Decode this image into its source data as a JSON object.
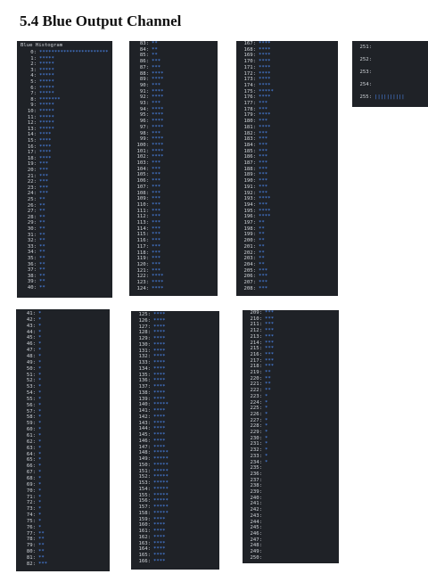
{
  "title": "5.4 Blue Output Channel",
  "histogram_header": "Blue Histogram",
  "panels": [
    {
      "id": "p1",
      "rows": [
        [
          "0:",
          "***********************"
        ],
        [
          "1:",
          "*****"
        ],
        [
          "2:",
          "*****"
        ],
        [
          "3:",
          "*****"
        ],
        [
          "4:",
          "*****"
        ],
        [
          "5:",
          "*****"
        ],
        [
          "6:",
          "*****"
        ],
        [
          "7:",
          "*****"
        ],
        [
          "8:",
          "*******"
        ],
        [
          "9:",
          "*****"
        ],
        [
          "10:",
          "*****"
        ],
        [
          "11:",
          "*****"
        ],
        [
          "12:",
          "*****"
        ],
        [
          "13:",
          "*****"
        ],
        [
          "14:",
          "****"
        ],
        [
          "15:",
          "****"
        ],
        [
          "16:",
          "****"
        ],
        [
          "17:",
          "****"
        ],
        [
          "18:",
          "****"
        ],
        [
          "19:",
          "***"
        ],
        [
          "20:",
          "***"
        ],
        [
          "21:",
          "***"
        ],
        [
          "22:",
          "***"
        ],
        [
          "23:",
          "***"
        ],
        [
          "24:",
          "***"
        ],
        [
          "25:",
          "**"
        ],
        [
          "26:",
          "**"
        ],
        [
          "27:",
          "**"
        ],
        [
          "28:",
          "**"
        ],
        [
          "29:",
          "**"
        ],
        [
          "30:",
          "**"
        ],
        [
          "31:",
          "**"
        ],
        [
          "32:",
          "**"
        ],
        [
          "33:",
          "**"
        ],
        [
          "34:",
          "**"
        ],
        [
          "35:",
          "**"
        ],
        [
          "36:",
          "**"
        ],
        [
          "37:",
          "**"
        ],
        [
          "38:",
          "**"
        ],
        [
          "39:",
          "**"
        ],
        [
          "40:",
          "**"
        ]
      ]
    },
    {
      "id": "p2",
      "rows": [
        [
          "83:",
          "**"
        ],
        [
          "84:",
          "**"
        ],
        [
          "85:",
          "**"
        ],
        [
          "86:",
          "***"
        ],
        [
          "87:",
          "***"
        ],
        [
          "88:",
          "****"
        ],
        [
          "89:",
          "****"
        ],
        [
          "90:",
          "***"
        ],
        [
          "91:",
          "****"
        ],
        [
          "92:",
          "****"
        ],
        [
          "93:",
          "***"
        ],
        [
          "94:",
          "****"
        ],
        [
          "95:",
          "****"
        ],
        [
          "96:",
          "****"
        ],
        [
          "97:",
          "****"
        ],
        [
          "98:",
          "***"
        ],
        [
          "99:",
          "****"
        ],
        [
          "100:",
          "****"
        ],
        [
          "101:",
          "****"
        ],
        [
          "102:",
          "****"
        ],
        [
          "103:",
          "***"
        ],
        [
          "104:",
          "***"
        ],
        [
          "105:",
          "***"
        ],
        [
          "106:",
          "***"
        ],
        [
          "107:",
          "***"
        ],
        [
          "108:",
          "***"
        ],
        [
          "109:",
          "***"
        ],
        [
          "110:",
          "***"
        ],
        [
          "111:",
          "***"
        ],
        [
          "112:",
          "***"
        ],
        [
          "113:",
          "***"
        ],
        [
          "114:",
          "***"
        ],
        [
          "115:",
          "***"
        ],
        [
          "116:",
          "***"
        ],
        [
          "117:",
          "***"
        ],
        [
          "118:",
          "***"
        ],
        [
          "119:",
          "***"
        ],
        [
          "120:",
          "***"
        ],
        [
          "121:",
          "***"
        ],
        [
          "122:",
          "****"
        ],
        [
          "123:",
          "****"
        ],
        [
          "124:",
          "****"
        ]
      ]
    },
    {
      "id": "p3",
      "rows": [
        [
          "167:",
          "****"
        ],
        [
          "168:",
          "****"
        ],
        [
          "169:",
          "****"
        ],
        [
          "170:",
          "****"
        ],
        [
          "171:",
          "****"
        ],
        [
          "172:",
          "****"
        ],
        [
          "173:",
          "****"
        ],
        [
          "174:",
          "****"
        ],
        [
          "175:",
          "*****"
        ],
        [
          "176:",
          "****"
        ],
        [
          "177:",
          "***"
        ],
        [
          "178:",
          "***"
        ],
        [
          "179:",
          "****"
        ],
        [
          "180:",
          "***"
        ],
        [
          "181:",
          "****"
        ],
        [
          "182:",
          "***"
        ],
        [
          "183:",
          "***"
        ],
        [
          "184:",
          "***"
        ],
        [
          "185:",
          "***"
        ],
        [
          "186:",
          "***"
        ],
        [
          "187:",
          "***"
        ],
        [
          "188:",
          "***"
        ],
        [
          "189:",
          "***"
        ],
        [
          "190:",
          "***"
        ],
        [
          "191:",
          "***"
        ],
        [
          "192:",
          "***"
        ],
        [
          "193:",
          "****"
        ],
        [
          "194:",
          "***"
        ],
        [
          "195:",
          "****"
        ],
        [
          "196:",
          "****"
        ],
        [
          "197:",
          "**"
        ],
        [
          "198:",
          "**"
        ],
        [
          "199:",
          "**"
        ],
        [
          "200:",
          "**"
        ],
        [
          "201:",
          "**"
        ],
        [
          "202:",
          "**"
        ],
        [
          "203:",
          "**"
        ],
        [
          "204:",
          "**"
        ],
        [
          "205:",
          "***"
        ],
        [
          "206:",
          "***"
        ],
        [
          "207:",
          "***"
        ],
        [
          "208:",
          "***"
        ]
      ]
    },
    {
      "id": "p4",
      "rows": [
        [
          "251:",
          ""
        ],
        [
          "252:",
          ""
        ],
        [
          "253:",
          ""
        ],
        [
          "254:",
          ""
        ],
        [
          "255:",
          "||||||||||"
        ]
      ]
    },
    {
      "id": "p5",
      "rows": [
        [
          "41:",
          "*"
        ],
        [
          "42:",
          "*"
        ],
        [
          "43:",
          "*"
        ],
        [
          "44:",
          "*"
        ],
        [
          "45:",
          "*"
        ],
        [
          "46:",
          "*"
        ],
        [
          "47:",
          "*"
        ],
        [
          "48:",
          "*"
        ],
        [
          "49:",
          "*"
        ],
        [
          "50:",
          "*"
        ],
        [
          "51:",
          "*"
        ],
        [
          "52:",
          "*"
        ],
        [
          "53:",
          "*"
        ],
        [
          "54:",
          "*"
        ],
        [
          "55:",
          "*"
        ],
        [
          "56:",
          "*"
        ],
        [
          "57:",
          "*"
        ],
        [
          "58:",
          "*"
        ],
        [
          "59:",
          "*"
        ],
        [
          "60:",
          "*"
        ],
        [
          "61:",
          "*"
        ],
        [
          "62:",
          "*"
        ],
        [
          "63:",
          "*"
        ],
        [
          "64:",
          "*"
        ],
        [
          "65:",
          "*"
        ],
        [
          "66:",
          "*"
        ],
        [
          "67:",
          "*"
        ],
        [
          "68:",
          "*"
        ],
        [
          "69:",
          "*"
        ],
        [
          "70:",
          "*"
        ],
        [
          "71:",
          "*"
        ],
        [
          "72:",
          "*"
        ],
        [
          "73:",
          "*"
        ],
        [
          "74:",
          "*"
        ],
        [
          "75:",
          "*"
        ],
        [
          "76:",
          "*"
        ],
        [
          "77:",
          "**"
        ],
        [
          "78:",
          "**"
        ],
        [
          "79:",
          "**"
        ],
        [
          "80:",
          "**"
        ],
        [
          "81:",
          "**"
        ],
        [
          "82:",
          "***"
        ]
      ]
    },
    {
      "id": "p6",
      "rows": [
        [
          "125:",
          "****"
        ],
        [
          "126:",
          "****"
        ],
        [
          "127:",
          "****"
        ],
        [
          "128:",
          "****"
        ],
        [
          "129:",
          "****"
        ],
        [
          "130:",
          "****"
        ],
        [
          "131:",
          "****"
        ],
        [
          "132:",
          "****"
        ],
        [
          "133:",
          "****"
        ],
        [
          "134:",
          "****"
        ],
        [
          "135:",
          "****"
        ],
        [
          "136:",
          "****"
        ],
        [
          "137:",
          "****"
        ],
        [
          "138:",
          "****"
        ],
        [
          "139:",
          "****"
        ],
        [
          "140:",
          "*****"
        ],
        [
          "141:",
          "****"
        ],
        [
          "142:",
          "****"
        ],
        [
          "143:",
          "****"
        ],
        [
          "144:",
          "****"
        ],
        [
          "145:",
          "****"
        ],
        [
          "146:",
          "****"
        ],
        [
          "147:",
          "****"
        ],
        [
          "148:",
          "*****"
        ],
        [
          "149:",
          "*****"
        ],
        [
          "150:",
          "*****"
        ],
        [
          "151:",
          "*****"
        ],
        [
          "152:",
          "*****"
        ],
        [
          "153:",
          "*****"
        ],
        [
          "154:",
          "*****"
        ],
        [
          "155:",
          "*****"
        ],
        [
          "156:",
          "*****"
        ],
        [
          "157:",
          "*****"
        ],
        [
          "158:",
          "*****"
        ],
        [
          "159:",
          "****"
        ],
        [
          "160:",
          "****"
        ],
        [
          "161:",
          "****"
        ],
        [
          "162:",
          "****"
        ],
        [
          "163:",
          "****"
        ],
        [
          "164:",
          "****"
        ],
        [
          "165:",
          "****"
        ],
        [
          "166:",
          "****"
        ]
      ]
    },
    {
      "id": "p7",
      "rows": [
        [
          "209:",
          "***"
        ],
        [
          "210:",
          "***"
        ],
        [
          "211:",
          "***"
        ],
        [
          "212:",
          "***"
        ],
        [
          "213:",
          "***"
        ],
        [
          "214:",
          "***"
        ],
        [
          "215:",
          "***"
        ],
        [
          "216:",
          "***"
        ],
        [
          "217:",
          "***"
        ],
        [
          "218:",
          "***"
        ],
        [
          "219:",
          "**"
        ],
        [
          "220:",
          "**"
        ],
        [
          "221:",
          "**"
        ],
        [
          "222:",
          "**"
        ],
        [
          "223:",
          "*"
        ],
        [
          "224:",
          "*"
        ],
        [
          "225:",
          "*"
        ],
        [
          "226:",
          "*"
        ],
        [
          "227:",
          "*"
        ],
        [
          "228:",
          "*"
        ],
        [
          "229:",
          "*"
        ],
        [
          "230:",
          "*"
        ],
        [
          "231:",
          "*"
        ],
        [
          "232:",
          "*"
        ],
        [
          "233:",
          "*"
        ],
        [
          "234:",
          "*"
        ],
        [
          "235:",
          ""
        ],
        [
          "236:",
          ""
        ],
        [
          "237:",
          ""
        ],
        [
          "238:",
          ""
        ],
        [
          "239:",
          ""
        ],
        [
          "240:",
          ""
        ],
        [
          "241:",
          ""
        ],
        [
          "242:",
          ""
        ],
        [
          "243:",
          ""
        ],
        [
          "244:",
          ""
        ],
        [
          "245:",
          ""
        ],
        [
          "246:",
          ""
        ],
        [
          "247:",
          ""
        ],
        [
          "248:",
          ""
        ],
        [
          "249:",
          ""
        ],
        [
          "250:",
          ""
        ]
      ]
    }
  ]
}
